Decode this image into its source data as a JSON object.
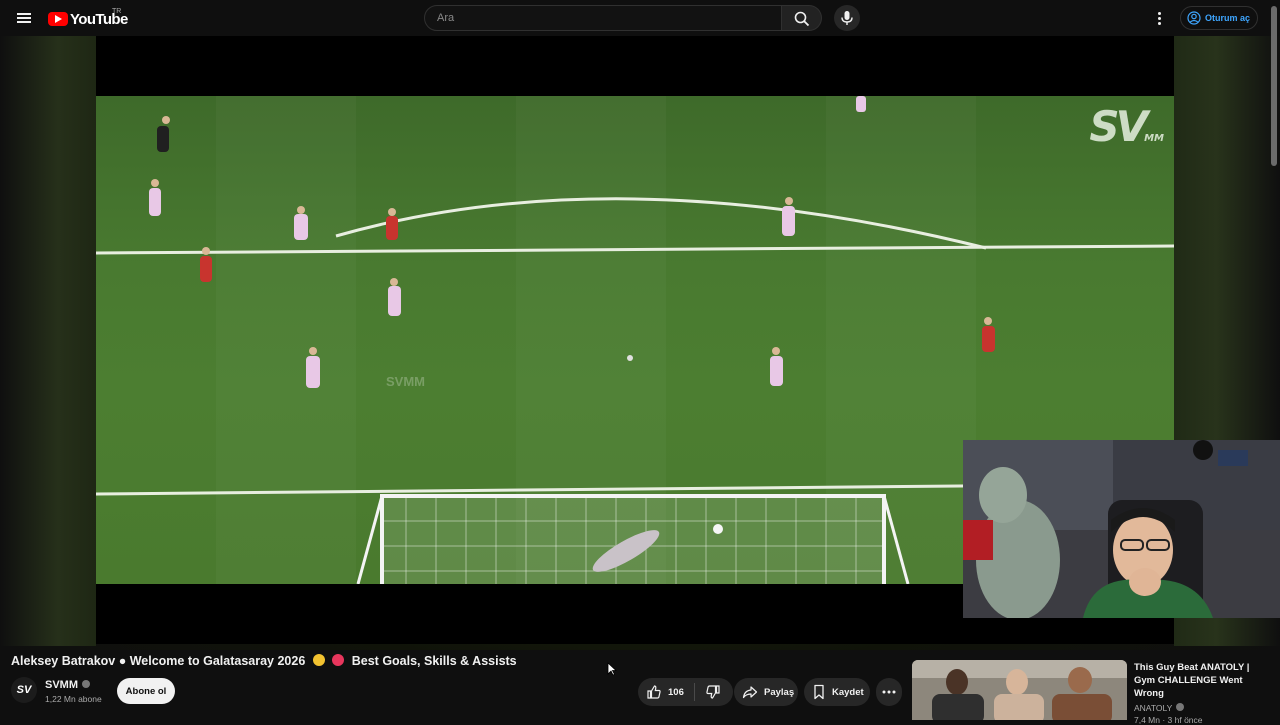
{
  "header": {
    "logo_text": "YouTube",
    "country_code": "TR",
    "search_placeholder": "Ara",
    "signin_label": "Oturum aç"
  },
  "player": {
    "watermark_logo": "SV",
    "watermark_logo_sub": "MM",
    "watermark_center": "SVMM"
  },
  "video": {
    "title_part1": "Aleksey Batrakov ● Welcome to Galatasaray 2026",
    "title_part2": "Best Goals, Skills & Assists",
    "emoji_colors": [
      "#f2c230",
      "#e8365d"
    ],
    "channel_name": "SVMM",
    "channel_avatar_text": "SV",
    "subscribers": "1,22 Mn abone",
    "subscribe_label": "Abone ol",
    "like_count": "106",
    "share_label": "Paylaş",
    "save_label": "Kaydet"
  },
  "recommendation": {
    "title": "This Guy Beat ANATOLY | Gym CHALLENGE Went Wrong",
    "channel": "ANATOLY",
    "meta": "7,4 Mn · 3 hf önce"
  },
  "colors": {
    "accent_link": "#3ea6ff",
    "logo_red": "#ff0000",
    "background": "#0f0f0f"
  }
}
